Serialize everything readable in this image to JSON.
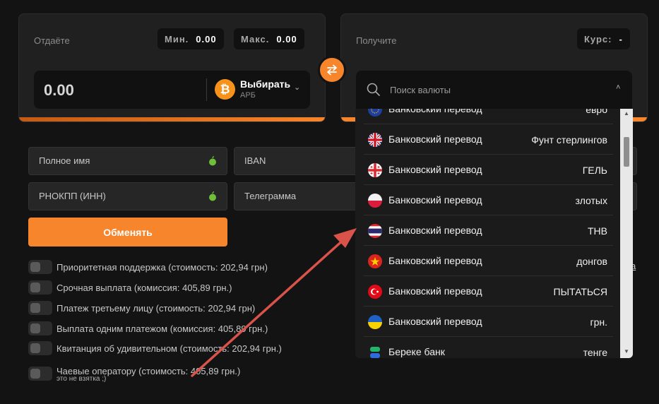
{
  "give": {
    "label": "Отдаёте",
    "min_label": "Мин.",
    "min_value": "0.00",
    "max_label": "Макс.",
    "max_value": "0.00",
    "amount": "0.00",
    "select_label": "Выбирать",
    "select_sub": "АРБ"
  },
  "get": {
    "label": "Получите",
    "rate_label": "Курс:",
    "rate_value": "-",
    "search_placeholder": "Поиск валюты"
  },
  "form": {
    "full_name": "Полное имя",
    "iban": "IBAN",
    "inn": "РНОКПП (ИНН)",
    "telegram": "Телеграмма",
    "exchange_button": "Обменять"
  },
  "options": [
    {
      "label": "Приоритетная поддержка (стоимость: 202,94 грн)"
    },
    {
      "label": "Срочная выплата (комиссия: 405,89 грн.)"
    },
    {
      "label": "Платеж третьему лицу (стоимость: 202,94 грн)"
    },
    {
      "label": "Выплата одним платежом (комиссия: 405,89 грн.)"
    },
    {
      "label": "Квитанция об удивительном (стоимость: 202,94 грн.)"
    },
    {
      "label": "Чаевые оператору (стоимость: 405,89 грн.)"
    }
  ],
  "tip_note": "это не взятка ;)",
  "dropdown": {
    "items": [
      {
        "name": "Банковский перевод",
        "currency": "евро",
        "flag": "eu"
      },
      {
        "name": "Банковский перевод",
        "currency": "Фунт стерлингов",
        "flag": "gb"
      },
      {
        "name": "Банковский перевод",
        "currency": "ГЕЛЬ",
        "flag": "ge"
      },
      {
        "name": "Банковский перевод",
        "currency": "злотых",
        "flag": "pl"
      },
      {
        "name": "Банковский перевод",
        "currency": "THB",
        "flag": "th"
      },
      {
        "name": "Банковский перевод",
        "currency": "донгов",
        "flag": "vn"
      },
      {
        "name": "Банковский перевод",
        "currency": "ПЫТАТЬСЯ",
        "flag": "tr"
      },
      {
        "name": "Банковский перевод",
        "currency": "грн.",
        "flag": "ua"
      },
      {
        "name": "Береке банк",
        "currency": "тенге",
        "flag": "bereke"
      }
    ]
  },
  "right_link": "а",
  "colors": {
    "accent": "#f7852b",
    "background": "#131313",
    "panel": "#202020"
  }
}
